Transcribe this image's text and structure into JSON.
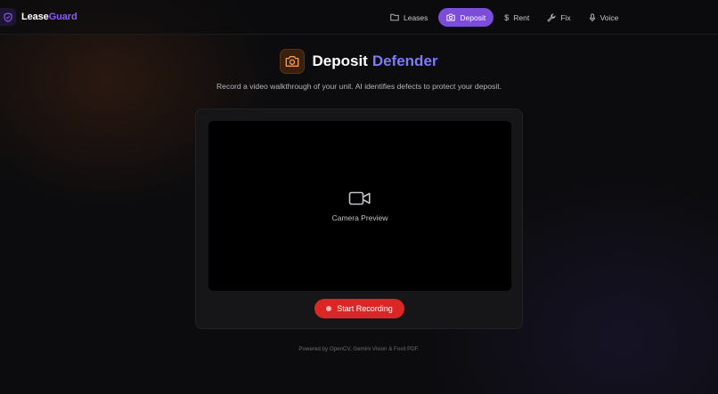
{
  "brand": {
    "name_part1": "Lease",
    "name_part2": "Guard",
    "logo_icon": "shield-icon"
  },
  "nav": {
    "items": [
      {
        "label": "Leases",
        "icon": "folder-icon",
        "active": false
      },
      {
        "label": "Deposit",
        "icon": "camera-icon",
        "active": true
      },
      {
        "label": "Rent",
        "icon": "dollar-icon",
        "active": false
      },
      {
        "label": "Fix",
        "icon": "wrench-icon",
        "active": false
      },
      {
        "label": "Voice",
        "icon": "mic-icon",
        "active": false
      }
    ]
  },
  "page": {
    "title_part1": "Deposit",
    "title_part2": "Defender",
    "title_icon": "camera-icon",
    "subtitle": "Record a video walkthrough of your unit. AI identifies defects to protect your deposit."
  },
  "camera": {
    "preview_label": "Camera Preview",
    "preview_icon": "video-camera-icon",
    "record_button_label": "Start Recording"
  },
  "footer": {
    "text": "Powered by OpenCV, Gemini Vision & Foxit PDF."
  },
  "colors": {
    "accent": "#7c4ddb",
    "brand_accent": "#8b5cf6",
    "title_accent": "#7c7cf5",
    "record": "#dc2626",
    "background": "#0c0c0e"
  }
}
